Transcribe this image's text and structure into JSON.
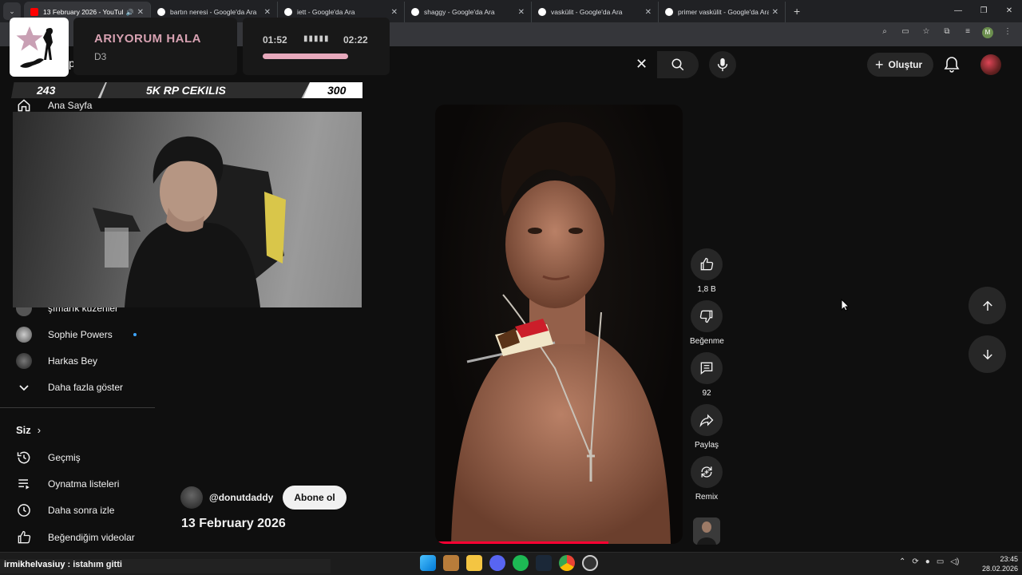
{
  "browser": {
    "tabs": [
      {
        "title": "13 February 2026 - YouTube",
        "active": true,
        "favicon": "youtube-icon"
      },
      {
        "title": "bartın neresi - Google'da Ara",
        "active": false,
        "favicon": "google-icon"
      },
      {
        "title": "iett - Google'da Ara",
        "active": false,
        "favicon": "google-icon"
      },
      {
        "title": "shaggy - Google'da Ara",
        "active": false,
        "favicon": "google-icon"
      },
      {
        "title": "vaskülit - Google'da Ara",
        "active": false,
        "favicon": "google-icon"
      },
      {
        "title": "primer vaskülit - Google'da Ara",
        "active": false,
        "favicon": "google-icon"
      }
    ],
    "profile_initial": "M"
  },
  "overlay": {
    "now_playing": {
      "title": "ARIYORUM HALA",
      "artist": "D3",
      "current_time": "01:52",
      "duration": "02:22",
      "progress": 0.79
    },
    "rp_banner": {
      "left_value": "243",
      "label": "5K RP CEKILIS",
      "right_value": "300"
    },
    "chat": {
      "user": "irmikhelvasiuy",
      "message": " : istahım gitti"
    }
  },
  "youtube": {
    "header": {
      "search_partial": "p",
      "create_label": "Oluştur"
    },
    "sidebar": {
      "home_label": "Ana Sayfa",
      "subscriptions": [
        {
          "name": "şımarık kuzenler",
          "new": false
        },
        {
          "name": "Sophie Powers",
          "new": true
        },
        {
          "name": "Harkas Bey",
          "new": false
        }
      ],
      "show_more": "Daha fazla göster",
      "you_section": "Siz",
      "you_items": [
        {
          "label": "Geçmiş",
          "icon": "history-icon"
        },
        {
          "label": "Oynatma listeleri",
          "icon": "playlists-icon"
        },
        {
          "label": "Daha sonra izle",
          "icon": "watch-later-icon"
        },
        {
          "label": "Beğendiğim videolar",
          "icon": "liked-icon"
        }
      ]
    },
    "short": {
      "channel": "@donutdaddy",
      "subscribe_label": "Abone ol",
      "title": "13 February 2026",
      "progress": 0.7,
      "actions": {
        "like_count": "1,8 B",
        "dislike_label": "Beğenme",
        "comment_count": "92",
        "share_label": "Paylaş",
        "remix_label": "Remix"
      }
    }
  },
  "taskbar": {
    "time": "23:45",
    "date": "28.02.2026"
  },
  "colors": {
    "accent_red": "#ff0033",
    "np_pink": "#d8a2b2",
    "link_blue": "#3ea6ff"
  }
}
